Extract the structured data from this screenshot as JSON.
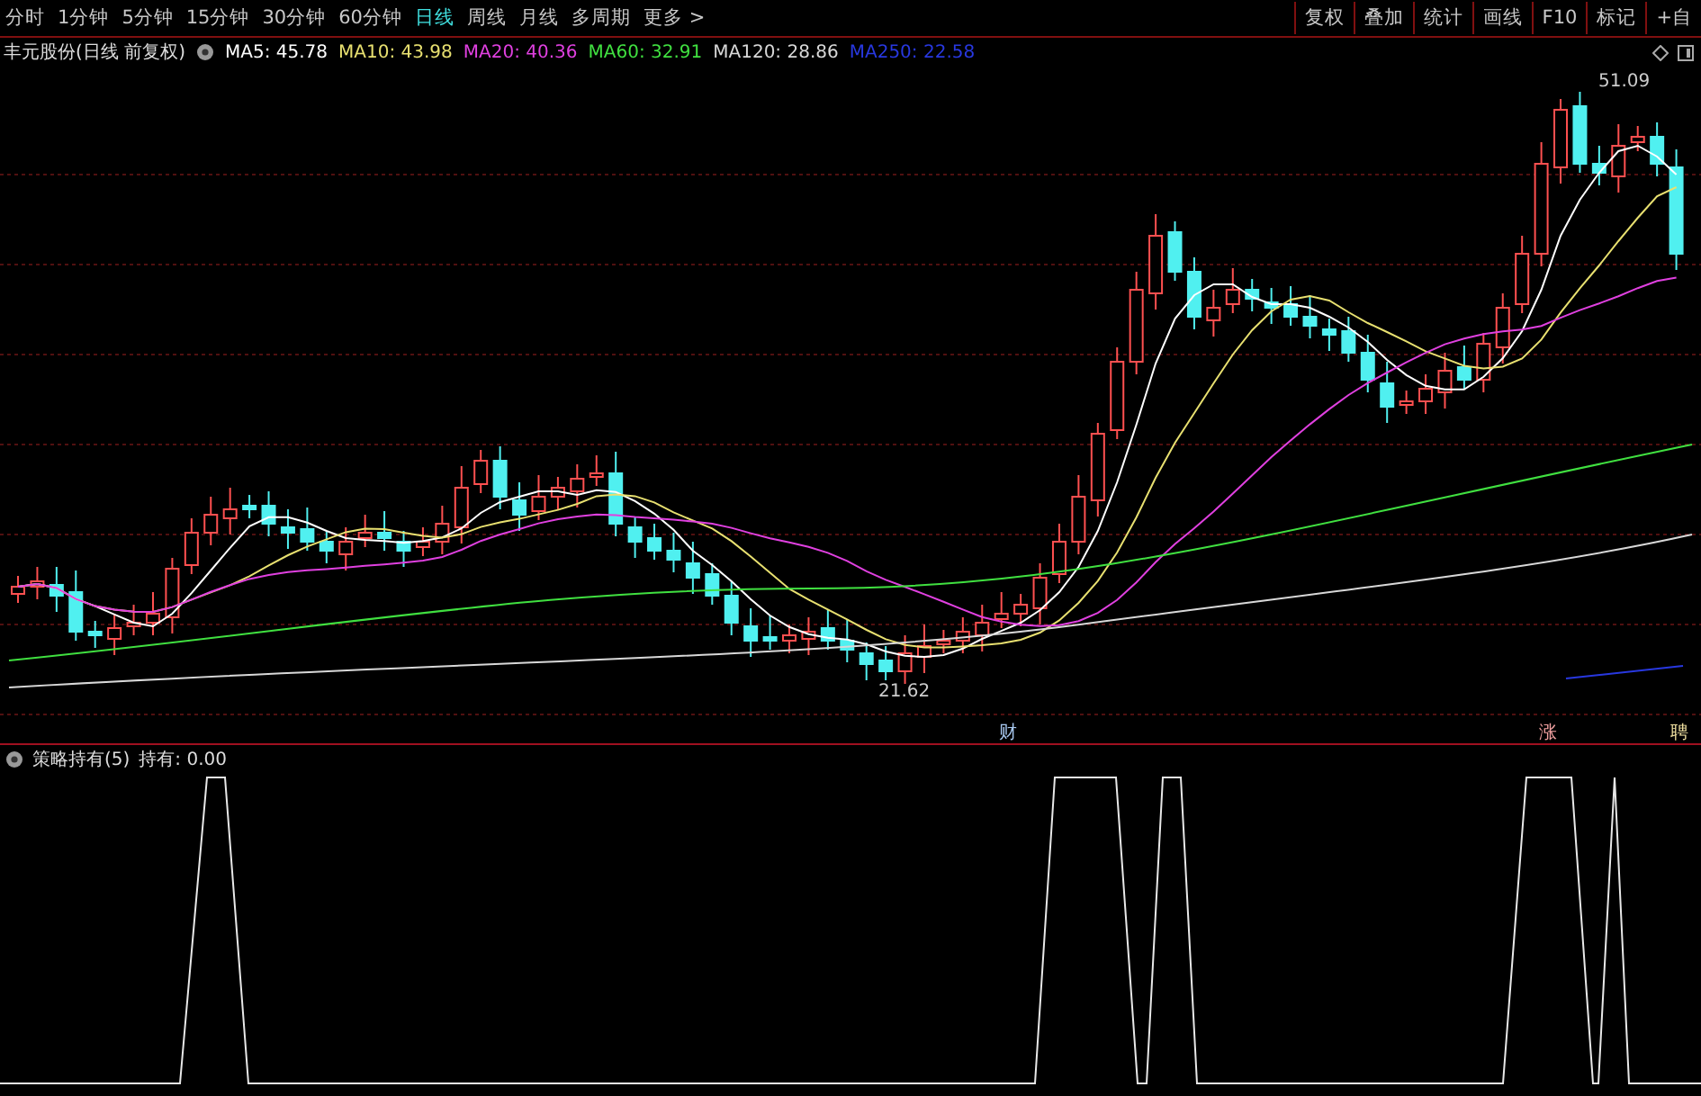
{
  "period_tabs": [
    {
      "label": "分时",
      "selected": false
    },
    {
      "label": "1分钟",
      "selected": false
    },
    {
      "label": "5分钟",
      "selected": false
    },
    {
      "label": "15分钟",
      "selected": false
    },
    {
      "label": "30分钟",
      "selected": false
    },
    {
      "label": "60分钟",
      "selected": false
    },
    {
      "label": "日线",
      "selected": true
    },
    {
      "label": "周线",
      "selected": false
    },
    {
      "label": "月线",
      "selected": false
    },
    {
      "label": "多周期",
      "selected": false
    },
    {
      "label": "更多 >",
      "selected": false
    }
  ],
  "toolbar_buttons": [
    "复权",
    "叠加",
    "统计",
    "画线",
    "F10",
    "标记",
    "+自"
  ],
  "main_chart": {
    "title": "丰元股份(日线 前复权)",
    "moving_averages": [
      {
        "label": "MA5: 45.78",
        "color": "#ffffff"
      },
      {
        "label": "MA10: 43.98",
        "color": "#e8e070"
      },
      {
        "label": "MA20: 40.36",
        "color": "#e040e0"
      },
      {
        "label": "MA60: 32.91",
        "color": "#40e040"
      },
      {
        "label": "MA120: 28.86",
        "color": "#d8d8d8"
      },
      {
        "label": "MA250: 22.58",
        "color": "#2838e0"
      }
    ],
    "high_label": "51.09",
    "low_label": "21.62",
    "event_markers": [
      {
        "label": "财",
        "color": "#a8c8f0"
      },
      {
        "label": "涨",
        "color": "#f0a0a0"
      },
      {
        "label": "聘",
        "color": "#f0e0a0"
      }
    ]
  },
  "indicator_panel": {
    "title": "策略持有(5)",
    "reading": "持有: 0.00"
  }
}
